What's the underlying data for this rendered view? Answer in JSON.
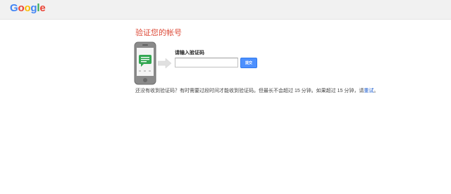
{
  "header": {
    "logo": [
      "G",
      "o",
      "o",
      "g",
      "l",
      "e"
    ],
    "logo_colors": [
      "#4285f4",
      "#ea4335",
      "#fbbc05",
      "#4285f4",
      "#34a853",
      "#ea4335"
    ]
  },
  "main": {
    "title": "验证您的帐号",
    "code_label": "请输入验证码",
    "code_input": {
      "value": "",
      "placeholder": ""
    },
    "submit_label": "提交",
    "help_text": "还没有收到验证码？有时需要过段时间才能收到验证码。但最长不会超过 15 分钟。如果超过 15 分钟，请",
    "retry_link": "重试",
    "help_suffix": "。"
  },
  "icons": {
    "phone": "phone-message-icon",
    "arrow": "arrow-right-icon"
  },
  "colors": {
    "title": "#dd4b39",
    "button": "#4d90fe",
    "link": "#1155cc",
    "message_green": "#34a853"
  }
}
